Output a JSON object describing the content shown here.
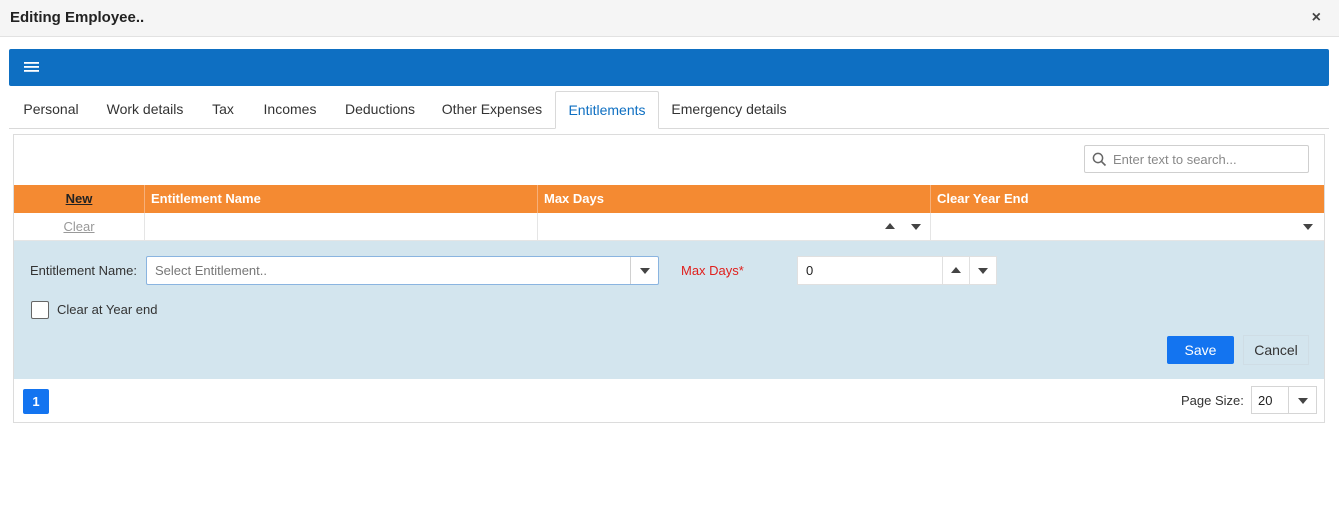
{
  "window": {
    "title": "Editing Employee..",
    "close_label": "×"
  },
  "toolbar": {
    "menu_icon": "hamburger-menu-icon",
    "color": "#0e6fc2"
  },
  "tabs": [
    {
      "label": "Personal",
      "active": false
    },
    {
      "label": "Work details",
      "active": false
    },
    {
      "label": "Tax",
      "active": false
    },
    {
      "label": "Incomes",
      "active": false
    },
    {
      "label": "Deductions",
      "active": false
    },
    {
      "label": "Other Expenses",
      "active": false
    },
    {
      "label": "Entitlements",
      "active": true
    },
    {
      "label": "Emergency details",
      "active": false
    }
  ],
  "search": {
    "placeholder": "Enter text to search..."
  },
  "grid": {
    "header_color": "#f48a32",
    "columns": {
      "new_label": "New",
      "entitlement_name": "Entitlement Name",
      "max_days": "Max Days",
      "clear_year_end": "Clear Year End"
    },
    "filter_row": {
      "clear_label": "Clear"
    }
  },
  "edit_form": {
    "entitlement_label": "Entitlement Name:",
    "entitlement_placeholder": "Select Entitlement..",
    "max_days_label": "Max Days*",
    "max_days_value": "0",
    "clear_year_end_label": "Clear at Year end",
    "clear_year_end_checked": false,
    "save_label": "Save",
    "cancel_label": "Cancel"
  },
  "pager": {
    "current_page": "1",
    "page_size_label": "Page Size:",
    "page_size_value": "20"
  }
}
